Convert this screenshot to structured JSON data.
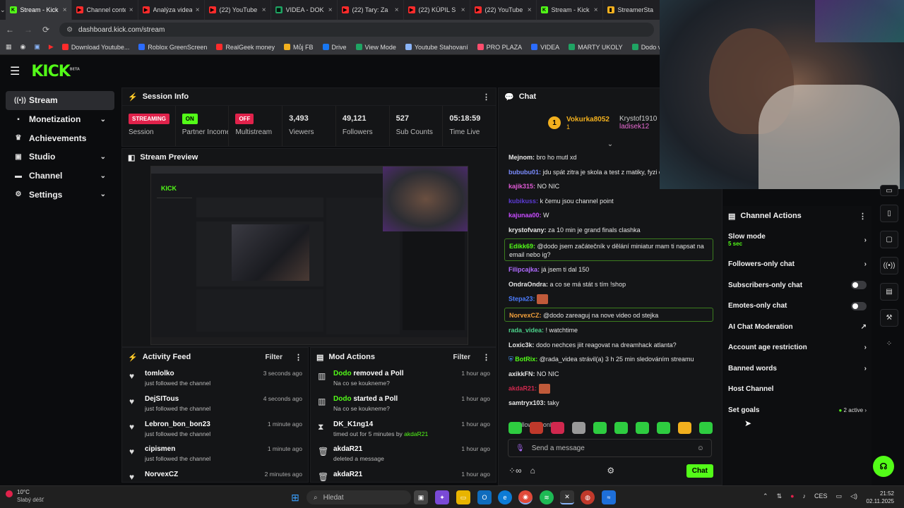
{
  "browser": {
    "tabs": [
      {
        "label": "Stream - Kick",
        "icon": "kick-icon",
        "active": true
      },
      {
        "label": "Channel content",
        "icon": "youtube-icon"
      },
      {
        "label": "Analýza videa",
        "icon": "youtube-icon"
      },
      {
        "label": "(22) YouTube",
        "icon": "youtube-icon"
      },
      {
        "label": "VIDEA - DOK",
        "icon": "sheets-icon"
      },
      {
        "label": "(22) Tary: Za",
        "icon": "youtube-icon"
      },
      {
        "label": "(22) KÚPIL S",
        "icon": "youtube-icon"
      },
      {
        "label": "(22) YouTube",
        "icon": "youtube-icon"
      },
      {
        "label": "Stream - Kick",
        "icon": "kick-icon"
      },
      {
        "label": "StreamerSta",
        "icon": "chart-icon"
      }
    ],
    "url": "dashboard.kick.com/stream",
    "bookmarks": [
      "Download Youtube...",
      "Roblox GreenScreen",
      "RealGeek money",
      "Můj FB",
      "Drive",
      "View Mode",
      "Youtube Stahovaní",
      "PRO PLAZA",
      "VIDEA",
      "MARTY UKOLY",
      "Dodo videa"
    ]
  },
  "logo": "KICK",
  "logo_sup": "BETA",
  "sidebar": {
    "items": [
      {
        "label": "Stream",
        "icon": "stream-icon",
        "active": true,
        "chevron": false
      },
      {
        "label": "Monetization",
        "icon": "monetization-icon",
        "active": false,
        "chevron": true
      },
      {
        "label": "Achievements",
        "icon": "trophy-icon",
        "active": false,
        "chevron": false
      },
      {
        "label": "Studio",
        "icon": "studio-icon",
        "active": false,
        "chevron": true
      },
      {
        "label": "Channel",
        "icon": "channel-icon",
        "active": false,
        "chevron": true
      },
      {
        "label": "Settings",
        "icon": "gear-icon",
        "active": false,
        "chevron": true
      }
    ]
  },
  "session": {
    "title": "Session Info",
    "streaming": {
      "badge": "STREAMING",
      "label": "Session"
    },
    "partner": {
      "badge": "ON",
      "label": "Partner Income"
    },
    "multistream": {
      "badge": "OFF",
      "label": "Multistream"
    },
    "viewers": {
      "value": "3,493",
      "label": "Viewers"
    },
    "followers": {
      "value": "49,121",
      "label": "Followers"
    },
    "subs": {
      "value": "527",
      "label": "Sub Counts"
    },
    "time": {
      "value": "05:18:59",
      "label": "Time Live"
    }
  },
  "preview": {
    "title": "Stream Preview",
    "logo": "KICK"
  },
  "activity": {
    "title": "Activity Feed",
    "filter": "Filter",
    "rows": [
      {
        "name": "tomlolko",
        "sub": "just followed the channel",
        "time": "3 seconds ago"
      },
      {
        "name": "DejSITous",
        "sub": "just followed the channel",
        "time": "4 seconds ago"
      },
      {
        "name": "Lebron_bon_bon23",
        "sub": "just followed the channel",
        "time": "1 minute ago"
      },
      {
        "name": "cipismen",
        "sub": "just followed the channel",
        "time": "1 minute ago"
      },
      {
        "name": "NorvexCZ",
        "sub": "",
        "time": "2 minutes ago"
      }
    ]
  },
  "mod": {
    "title": "Mod Actions",
    "filter": "Filter",
    "rows": [
      {
        "user": "Dodo",
        "action": "removed a Poll",
        "sub": "Na co se koukneme?",
        "time": "1 hour ago",
        "icon": "poll-icon"
      },
      {
        "user": "Dodo",
        "action": "started a Poll",
        "sub": "Na co se koukneme?",
        "time": "1 hour ago",
        "icon": "poll-icon"
      },
      {
        "user": "DK_K1ng14",
        "action": "",
        "sub": "timed out for 5 minutes by",
        "sub2": "akdaR21",
        "time": "1 hour ago",
        "icon": "hourglass-icon"
      },
      {
        "user": "akdaR21",
        "action": "",
        "sub": "deleted a message",
        "time": "1 hour ago",
        "icon": "trash-icon"
      },
      {
        "user": "akdaR21",
        "action": "",
        "sub": "",
        "time": "1 hour ago",
        "icon": "trash-icon"
      }
    ]
  },
  "chat": {
    "title": "Chat",
    "pinned": {
      "rank": "1",
      "user1": "Vokurka8052",
      "count": "1",
      "user2": "Krystof1910",
      "user3": "ladisek12"
    },
    "messages": [
      {
        "user": "Mejnom",
        "color": "#e6e6e6",
        "text": "bro ho mutl xd"
      },
      {
        "user": "bububu01",
        "color": "#7b8cff",
        "text": "jdu spát zitra je skola a test z matiky, fyzi chemie"
      },
      {
        "user": "kajik315",
        "color": "#e05ad6",
        "text": "NO NIC"
      },
      {
        "user": "kubikuss",
        "color": "#5c3bd6",
        "text": "k čemu jsou channel point"
      },
      {
        "user": "kajunaa00",
        "color": "#c84bff",
        "text": "W"
      },
      {
        "user": "krystofvany",
        "color": "#e6e6e6",
        "text": "za 10 min je grand finals clashka"
      },
      {
        "user": "Edikk69",
        "color": "#53fc18",
        "text": "@dodo jsem začátečník v dělání miniatur mam ti napsat na email nebo ig?",
        "highlight": true
      },
      {
        "user": "Filipcajka",
        "color": "#b06bff",
        "text": "já jsem ti dal 150"
      },
      {
        "user": "OndraOndra",
        "color": "#e6e6e6",
        "text": "a co se má stát s tím !shop"
      },
      {
        "user": "Stepa23",
        "color": "#4c7dff",
        "text": ""
      },
      {
        "user": "NorvexCZ",
        "color": "#f2a03b",
        "text": "@dodo zareaguj na nove video od stejka",
        "highlight": true
      },
      {
        "user": "rada_videa",
        "color": "#4cd18a",
        "text": "! watchtime"
      },
      {
        "user": "Loxic3k",
        "color": "#e6e6e6",
        "text": "dodo nechces jiit reagovat na dreamhack atlanta?"
      },
      {
        "user": "BotRix",
        "color": "#53fc18",
        "text": "@rada_videa strávil(a) 3 h 25 min sledováním streamu"
      },
      {
        "user": "axikkFN",
        "color": "#e6e6e6",
        "text": "NO NIC"
      },
      {
        "user": "akdaR21",
        "color": "#d0284e",
        "text": ""
      },
      {
        "user": "samtryx103",
        "color": "#e6e6e6",
        "text": "taky"
      }
    ],
    "followers_only": "Followers only",
    "placeholder": "Send a message",
    "send": "Chat"
  },
  "channel_actions": {
    "title": "Channel Actions",
    "slow_mode": "Slow mode",
    "slow_value": "5 sec",
    "followers_only": "Followers-only chat",
    "subscribers_only": "Subscribers-only chat",
    "emotes_only": "Emotes-only chat",
    "ai_moderation": "AI Chat Moderation",
    "age_restriction": "Account age restriction",
    "banned_words": "Banned words",
    "host": "Host Channel",
    "goals": "Set goals",
    "goals_active": "2 active"
  },
  "taskbar": {
    "weather_temp": "10°C",
    "weather_desc": "Slabý déšť",
    "search": "Hledat",
    "lang": "CES",
    "time": "21:52",
    "date": "02.11.2025"
  },
  "colors": {
    "accent": "#53fc18",
    "streaming": "#e0224b",
    "off": "#e0224b"
  }
}
